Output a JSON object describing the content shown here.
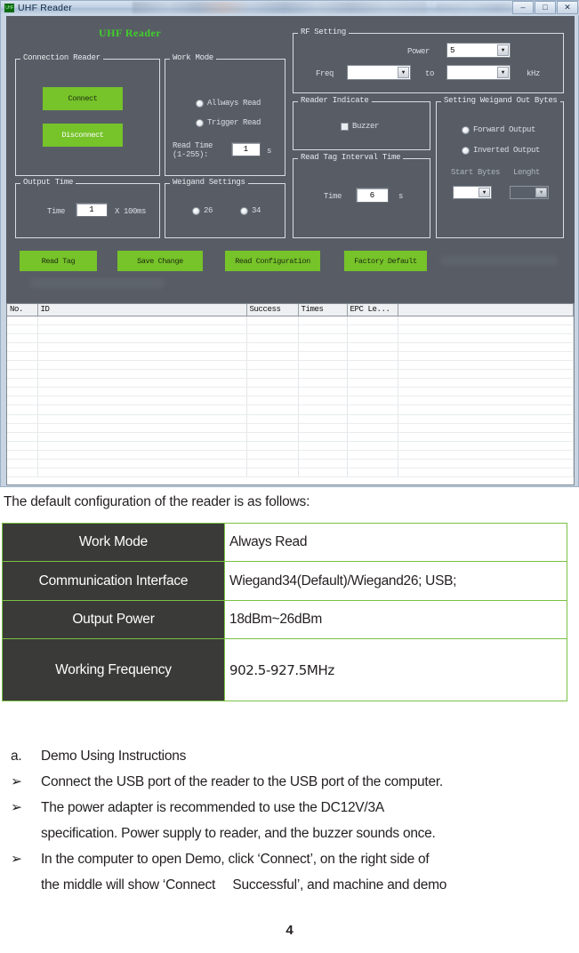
{
  "window": {
    "title": "UHF Reader",
    "icon": "app-icon",
    "controls": {
      "minimize": "–",
      "maximize": "□",
      "close": "✕"
    }
  },
  "form": {
    "heading": "UHF Reader",
    "connection_group": {
      "caption": "Connection Reader",
      "connect_button": "Connect",
      "disconnect_button": "Disconnect"
    },
    "work_mode_group": {
      "caption": "Work Mode",
      "always_read": "Allways Read",
      "trigger_read": "Trigger Read",
      "read_time_label_1": "Read Time",
      "read_time_label_2": "(1-255):",
      "read_time_value": "1",
      "read_time_unit": "s"
    },
    "output_time_group": {
      "caption": "Output Time",
      "time_label": "Time",
      "time_value": "1",
      "time_unit": "X 100ms"
    },
    "weigand_settings_group": {
      "caption": "Weigand Settings",
      "option_26": "26",
      "option_34": "34"
    },
    "rf_setting_group": {
      "caption": "RF Setting",
      "power_label": "Power",
      "power_value": "5",
      "freq_label": "Freq",
      "freq_from_value": "",
      "to_label": "to",
      "freq_to_value": "",
      "unit_label": "kHz"
    },
    "reader_indicate_group": {
      "caption": "Reader Indicate",
      "buzzer_label": "Buzzer"
    },
    "read_tag_interval_group": {
      "caption": "Read Tag Interval Time",
      "time_label": "Time",
      "time_value": "6",
      "time_unit": "s"
    },
    "weigand_out_bytes_group": {
      "caption": "Setting Weigand Out Bytes",
      "forward_output": "Forward Output",
      "inverted_output": "Inverted Output",
      "start_bytes_label": "Start Bytes",
      "start_bytes_value": "",
      "lenght_label": "Lenght",
      "lenght_value": ""
    },
    "actions": {
      "read_tag": "Read Tag",
      "save_change": "Save Change",
      "read_configuration": "Read Configuration",
      "factory_default": "Factory Default"
    },
    "grid": {
      "columns": [
        "No.",
        "ID",
        "Success",
        "Times",
        "EPC Le...",
        ""
      ],
      "rows": [],
      "empty_row_count": 18
    },
    "colors": {
      "form_background": "#585d65",
      "accent_green": "#76c32a",
      "title_green": "#41cf2a"
    }
  },
  "document": {
    "intro": "The default configuration of the reader is as follows:",
    "spec_table": [
      {
        "key": "Work Mode",
        "value": "Always Read"
      },
      {
        "key": "Communication Interface",
        "value": "Wiegand34(Default)/Wiegand26; USB;"
      },
      {
        "key": "Output Power",
        "value": "18dBm~26dBm"
      },
      {
        "key": "Working Frequency",
        "value": "902.5-927.5MHz"
      }
    ],
    "bullets": [
      {
        "marker": "a.",
        "text": "Demo Using Instructions",
        "cont": ""
      },
      {
        "marker": "➢",
        "text": "Connect the USB port of the reader to the USB port of the computer.",
        "cont": ""
      },
      {
        "marker": "➢",
        "text": "The power adapter is recommended to use the DC12V/3A",
        "cont": "specification. Power supply to reader, and the buzzer sounds once."
      },
      {
        "marker": "➢",
        "text": "In the computer to open Demo, click ‘Connect’, on the right side of",
        "cont": "the middle will show ‘Connect  Successful’, and machine and demo"
      }
    ],
    "page_number": "4",
    "colors": {
      "table_key_bg": "#3a3a38",
      "table_border_green": "#7ac143"
    }
  }
}
